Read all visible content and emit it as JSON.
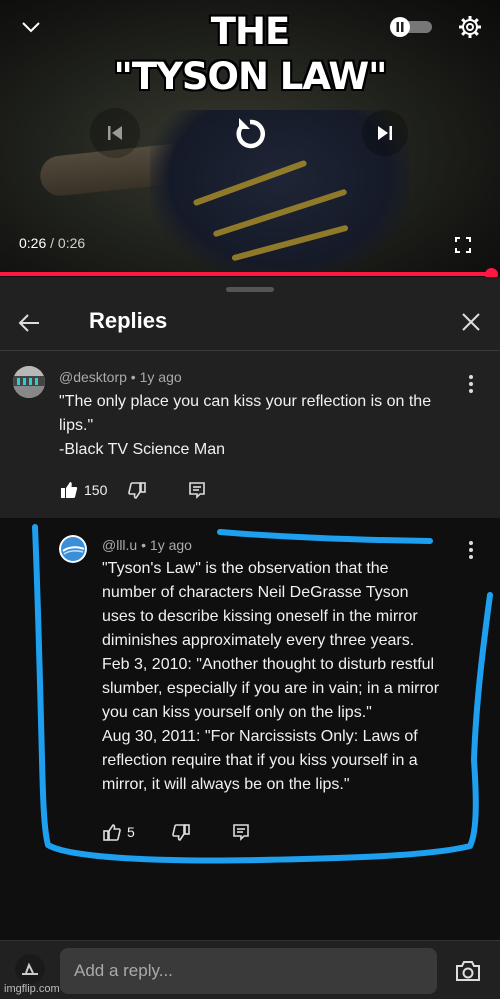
{
  "meme": {
    "title_line1": "THE",
    "title_line2": "\"TYSON LAW\""
  },
  "player": {
    "time_current": "0:26",
    "time_separator": " / ",
    "time_total": "0:26",
    "progress_fraction": 1.0,
    "autoplay_on": false,
    "icons": [
      "chevron-down-icon",
      "autoplay-pause-icon",
      "gear-icon",
      "previous-icon",
      "replay-icon",
      "next-icon",
      "fullscreen-icon"
    ]
  },
  "header": {
    "title": "Replies",
    "back_icon": "back-arrow-icon",
    "close_icon": "close-icon"
  },
  "comments": [
    {
      "author": "@desktorp",
      "age": "1y ago",
      "lines": [
        "\"The only place you can kiss your reflection is on the",
        "lips.\"",
        "-Black TV Science Man"
      ],
      "likes": "150"
    },
    {
      "author": "@lll.u",
      "age": "1y ago",
      "lines": [
        "\"Tyson's Law\" is the observation that the",
        "number of characters Neil DeGrasse Tyson",
        "uses to describe kissing oneself in the mirror",
        "diminishes approximately every three years.",
        "Feb 3, 2010: \"Another thought to disturb restful",
        "slumber, especially if you are in vain; in a mirror",
        "you can kiss yourself only on the lips.\"",
        "Aug 30, 2011: \"For Narcissists Only: Laws of",
        "reflection require that if you kiss yourself in a",
        "mirror, it will always be on the lips.\""
      ],
      "likes": "5"
    }
  ],
  "reply_box": {
    "placeholder": "Add a reply..."
  },
  "watermark": "imgflip.com",
  "colors": {
    "accent_red": "#ff1744",
    "highlight_blue": "#1ea0f0"
  }
}
